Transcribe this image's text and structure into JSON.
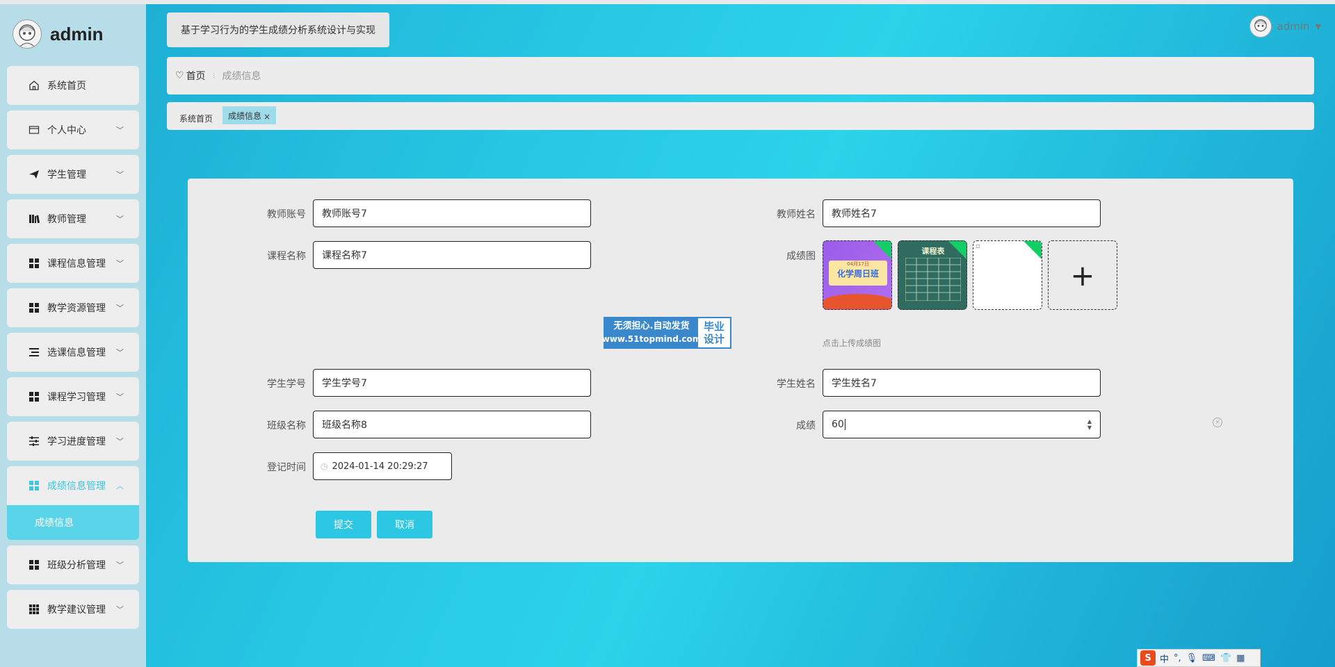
{
  "brand": {
    "name": "admin"
  },
  "sidebar": {
    "items": [
      {
        "label": "系统首页",
        "icon": "home-icon",
        "has_children": false
      },
      {
        "label": "个人中心",
        "icon": "card-icon",
        "has_children": true
      },
      {
        "label": "学生管理",
        "icon": "paper-plane-icon",
        "has_children": true
      },
      {
        "label": "教师管理",
        "icon": "books-icon",
        "has_children": true
      },
      {
        "label": "课程信息管理",
        "icon": "grid-icon",
        "has_children": true
      },
      {
        "label": "教学资源管理",
        "icon": "grid-icon",
        "has_children": true
      },
      {
        "label": "选课信息管理",
        "icon": "list-icon",
        "has_children": true
      },
      {
        "label": "课程学习管理",
        "icon": "grid-icon",
        "has_children": true
      },
      {
        "label": "学习进度管理",
        "icon": "sliders-icon",
        "has_children": true
      },
      {
        "label": "成绩信息管理",
        "icon": "grid-icon",
        "has_children": true,
        "active": true
      },
      {
        "label": "班级分析管理",
        "icon": "grid-icon",
        "has_children": true
      },
      {
        "label": "教学建议管理",
        "icon": "grid9-icon",
        "has_children": true
      }
    ],
    "submenu": {
      "label": "成绩信息"
    }
  },
  "header": {
    "title": "基于学习行为的学生成绩分析系统设计与实现",
    "user": "admin"
  },
  "breadcrumb": {
    "home": "首页",
    "current": "成绩信息"
  },
  "tags": {
    "first": "系统首页",
    "active": "成绩信息",
    "close": "×"
  },
  "form": {
    "teacher_account": {
      "label": "教师账号",
      "value": "教师账号7"
    },
    "teacher_name": {
      "label": "教师姓名",
      "value": "教师姓名7"
    },
    "course_name": {
      "label": "课程名称",
      "value": "课程名称7"
    },
    "score_image": {
      "label": "成绩图",
      "tip": "点击上传成绩图",
      "thumb1_text": "化学周日班",
      "thumb1_sub": "04月17日",
      "thumb2_text": "课程表"
    },
    "student_id": {
      "label": "学生学号",
      "value": "学生学号7"
    },
    "student_name": {
      "label": "学生姓名",
      "value": "学生姓名7"
    },
    "class_name": {
      "label": "班级名称",
      "value": "班级名称8"
    },
    "score": {
      "label": "成绩",
      "value": "60"
    },
    "register_time": {
      "label": "登记时间",
      "value": "2024-01-14 20:29:27"
    },
    "submit_label": "提交",
    "cancel_label": "取消"
  },
  "watermark": {
    "line1": "无须担心.自动发货",
    "line2": "www.51topmind.com",
    "right1": "毕业",
    "right2": "设计"
  },
  "ime": {
    "lang": "中"
  },
  "colors": {
    "accent": "#2cc7e3",
    "sidebar_bg": "#b6dde8",
    "active_text": "#3ec6df"
  }
}
